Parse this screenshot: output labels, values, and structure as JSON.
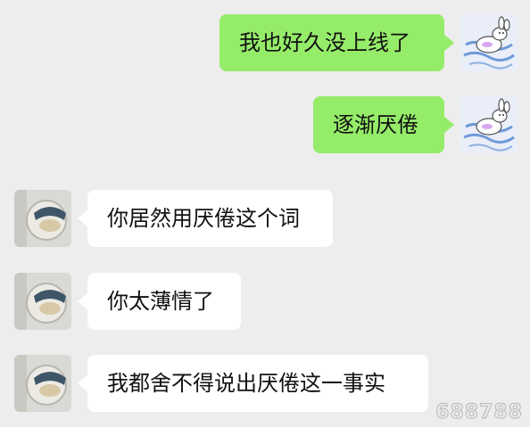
{
  "messages": [
    {
      "side": "out",
      "text": "我也好久没上线了"
    },
    {
      "side": "out",
      "text": "逐渐厌倦"
    },
    {
      "side": "in",
      "text": "你居然用厌倦这个词"
    },
    {
      "side": "in",
      "text": "你太薄情了"
    },
    {
      "side": "in",
      "text": "我都舍不得说出厌倦这一事实"
    }
  ],
  "watermark": "688788",
  "colors": {
    "background": "#ededed",
    "outgoing_bubble": "#95ec69",
    "incoming_bubble": "#ffffff"
  },
  "icons": {
    "self_avatar": "bunny-sticker-avatar",
    "contact_avatar": "photo-avatar"
  }
}
